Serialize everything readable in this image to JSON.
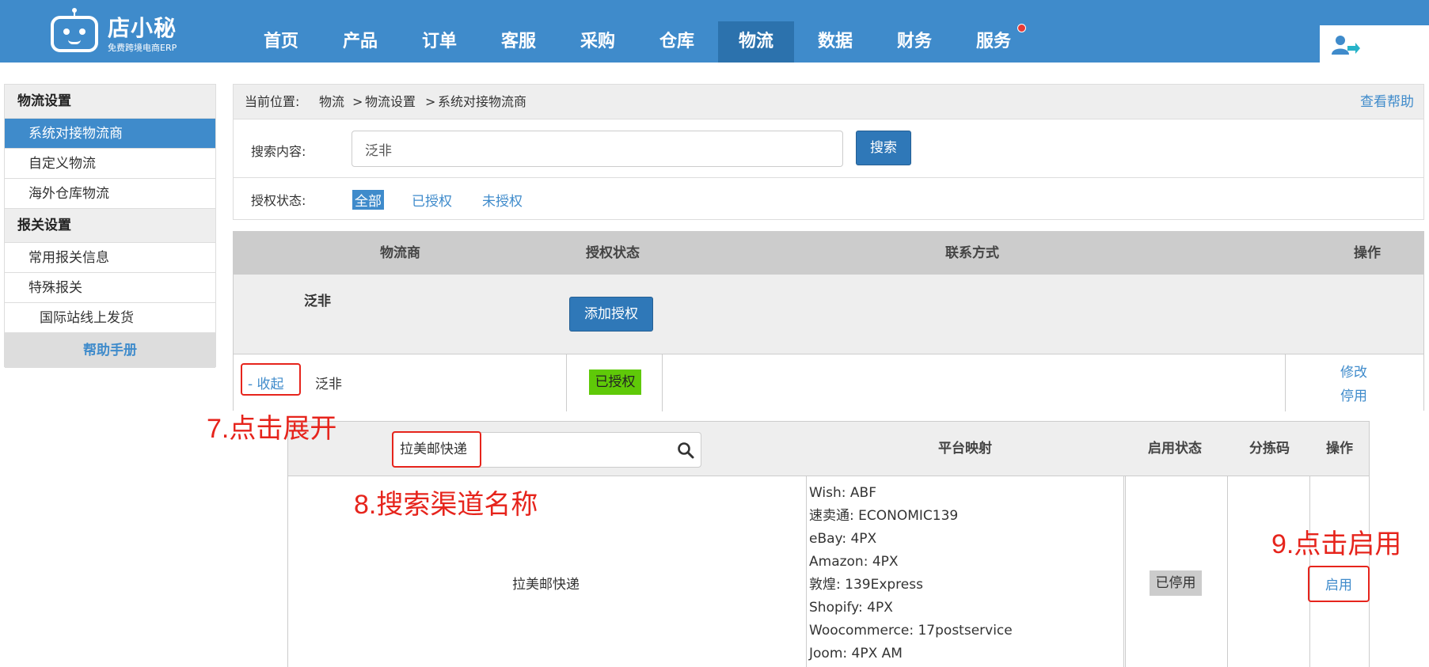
{
  "logo": {
    "title": "店小秘",
    "subtitle": "免费跨境电商ERP"
  },
  "nav": [
    "首页",
    "产品",
    "订单",
    "客服",
    "采购",
    "仓库",
    "物流",
    "数据",
    "财务",
    "服务"
  ],
  "sidebar": {
    "section1": "物流设置",
    "items1": [
      "系统对接物流商",
      "自定义物流",
      "海外仓库物流"
    ],
    "section2": "报关设置",
    "items2": [
      "常用报关信息",
      "特殊报关"
    ],
    "sub_item": "国际站线上发货",
    "help": "帮助手册"
  },
  "breadcrumb": {
    "label": "当前位置:",
    "c1": "物流",
    "c2": "物流设置",
    "c3": "系统对接物流商",
    "help": "查看帮助"
  },
  "search": {
    "label": "搜索内容:",
    "value": "泛非",
    "button": "搜索"
  },
  "auth_filter": {
    "label": "授权状态:",
    "options": [
      "全部",
      "已授权",
      "未授权"
    ]
  },
  "carrier_table": {
    "headers": [
      "物流商",
      "授权状态",
      "联系方式",
      "操作"
    ],
    "group_name": "泛非",
    "add_auth_button": "添加授权",
    "row": {
      "toggle": "- 收起",
      "name": "泛非",
      "status": "已授权",
      "actions": [
        "修改",
        "停用"
      ]
    }
  },
  "channel_table": {
    "search_value": "拉美邮快递",
    "headers": [
      "平台映射",
      "启用状态",
      "分拣码",
      "操作"
    ],
    "row": {
      "name": "拉美邮快递",
      "mappings": [
        "Wish: ABF",
        "速卖通: ECONOMIC139",
        "eBay: 4PX",
        "Amazon: 4PX",
        "敦煌: 139Express",
        "Shopify: 4PX",
        "Woocommerce: 17postservice",
        "Joom: 4PX AM"
      ],
      "status": "已停用",
      "action": "启用"
    }
  },
  "annotations": {
    "step7": "7.点击展开",
    "step8": "8.搜索渠道名称",
    "step9": "9.点击启用"
  },
  "colors": {
    "brand": "#3f8bcb",
    "nav_active": "#2c72ad",
    "annotation": "#e6241c",
    "authorized": "#5fc908"
  }
}
